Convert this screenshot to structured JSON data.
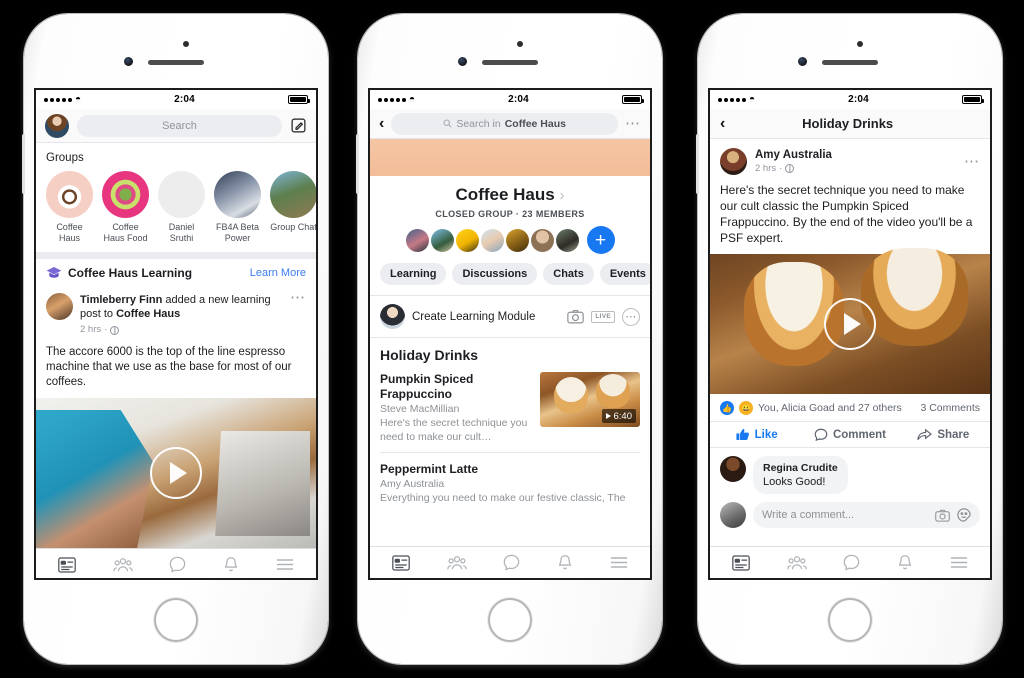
{
  "phones": [
    {
      "id": "phone-1",
      "status_bar": {
        "time": "2:04",
        "signal_dots": 5,
        "wifi_icon": "wifi-icon",
        "battery_icon": "battery-full-icon"
      },
      "search": {
        "placeholder": "Search",
        "compose_icon": "compose-icon",
        "avatar_icon": "user-avatar"
      },
      "groups": {
        "section_label": "Groups",
        "items": [
          {
            "name": "Coffee Haus",
            "icon": "group-avatar-coffee"
          },
          {
            "name": "Coffee Haus Food",
            "icon": "group-avatar-salad"
          },
          {
            "name": "Daniel Sruthi",
            "icon": "group-avatar-sketch"
          },
          {
            "name": "FB4A Beta Power",
            "icon": "group-avatar-fb4a"
          },
          {
            "name": "Group Chat",
            "icon": "group-avatar-chat"
          }
        ]
      },
      "learning_banner": {
        "icon": "graduation-cap-icon",
        "title": "Coffee Haus Learning",
        "action": "Learn More",
        "accent": "#7b68d6",
        "link_color": "#3b7cf0"
      },
      "post": {
        "author": "Timleberry Finn",
        "action_mid": " added a new learning post to ",
        "group": "Coffee Haus",
        "time": "2 hrs",
        "privacy_icon": "globe-icon",
        "more_icon": "more-options-icon",
        "body": "The accore 6000 is the top of the line espresso machine that we use as the base for most of our coffees.",
        "video": {
          "play_icon": "play-button-icon",
          "alt": "espresso-machine-video"
        }
      },
      "tabbar": [
        {
          "icon": "news-feed-icon",
          "name": "news-feed"
        },
        {
          "icon": "friends-icon",
          "name": "friends"
        },
        {
          "icon": "messenger-icon",
          "name": "messenger"
        },
        {
          "icon": "notifications-bell-icon",
          "name": "notifications"
        },
        {
          "icon": "hamburger-menu-icon",
          "name": "menu"
        }
      ]
    },
    {
      "id": "phone-2",
      "status_bar": {
        "time": "2:04"
      },
      "nav": {
        "back_icon": "back-chevron-icon",
        "search_icon": "search-icon",
        "search_prefix": "Search in ",
        "search_target": "Coffee Haus",
        "more_icon": "more-options-icon"
      },
      "group": {
        "cover_color": "#f2bd98",
        "name": "Coffee Haus",
        "name_chevron": "›",
        "subtitle": "CLOSED GROUP · 23 MEMBERS",
        "member_count": 7,
        "add_member_icon": "plus-icon",
        "add_member_color": "#1778f2"
      },
      "tabs": [
        {
          "label": "Learning"
        },
        {
          "label": "Discussions"
        },
        {
          "label": "Chats"
        },
        {
          "label": "Events"
        }
      ],
      "composer": {
        "prompt": "Create Learning Module",
        "camera_icon": "camera-icon",
        "live_label": "LIVE",
        "more_icon": "more-options-icon"
      },
      "list": {
        "title": "Holiday Drinks",
        "items": [
          {
            "name": "Pumpkin Spiced Frappuccino",
            "author": "Steve MacMillian",
            "desc": "Here's the secret technique you need to make our cult…",
            "duration": "6:40",
            "play_icon": "play-triangle-icon",
            "thumb": "pumpkin-frappuccino-thumb"
          },
          {
            "name": "Peppermint Latte",
            "author": "Amy Australia",
            "desc": "Everything you need to make our festive classic, The",
            "duration": "",
            "thumb": ""
          }
        ]
      },
      "tabbar": [
        {
          "icon": "news-feed-icon",
          "name": "news-feed"
        },
        {
          "icon": "friends-icon",
          "name": "friends"
        },
        {
          "icon": "messenger-icon",
          "name": "messenger"
        },
        {
          "icon": "notifications-bell-icon",
          "name": "notifications"
        },
        {
          "icon": "hamburger-menu-icon",
          "name": "menu"
        }
      ]
    },
    {
      "id": "phone-3",
      "status_bar": {
        "time": "2:04"
      },
      "nav": {
        "back_icon": "back-chevron-icon",
        "title": "Holiday Drinks"
      },
      "post": {
        "author": "Amy Australia",
        "time": "2 hrs",
        "privacy_icon": "globe-icon",
        "more_icon": "more-options-icon",
        "body": "Here's the secret technique you need to make our cult classic the Pumpkin Spiced Frappuccino. By the end of the video you'll be a PSF expert.",
        "video": {
          "play_icon": "play-button-icon",
          "alt": "pumpkin-spiced-frappuccino-video"
        }
      },
      "engagement": {
        "reaction_icons": [
          "like-reaction-icon",
          "haha-reaction-icon"
        ],
        "reaction_text": "You, Alicia Goad and 27 others",
        "comments": "3 Comments"
      },
      "actions": [
        {
          "label": "Like",
          "icon": "thumbs-up-icon",
          "active": true,
          "color": "#1778f2"
        },
        {
          "label": "Comment",
          "icon": "comment-bubble-icon",
          "active": false
        },
        {
          "label": "Share",
          "icon": "share-arrow-icon",
          "active": false
        }
      ],
      "comment": {
        "author": "Regina Crudite",
        "text": "Looks Good!"
      },
      "compose_comment": {
        "placeholder": "Write a comment...",
        "camera_icon": "camera-icon",
        "sticker_icon": "sticker-icon"
      },
      "tabbar": [
        {
          "icon": "news-feed-icon",
          "name": "news-feed"
        },
        {
          "icon": "friends-icon",
          "name": "friends"
        },
        {
          "icon": "messenger-icon",
          "name": "messenger"
        },
        {
          "icon": "notifications-bell-icon",
          "name": "notifications"
        },
        {
          "icon": "hamburger-menu-icon",
          "name": "menu"
        }
      ]
    }
  ]
}
